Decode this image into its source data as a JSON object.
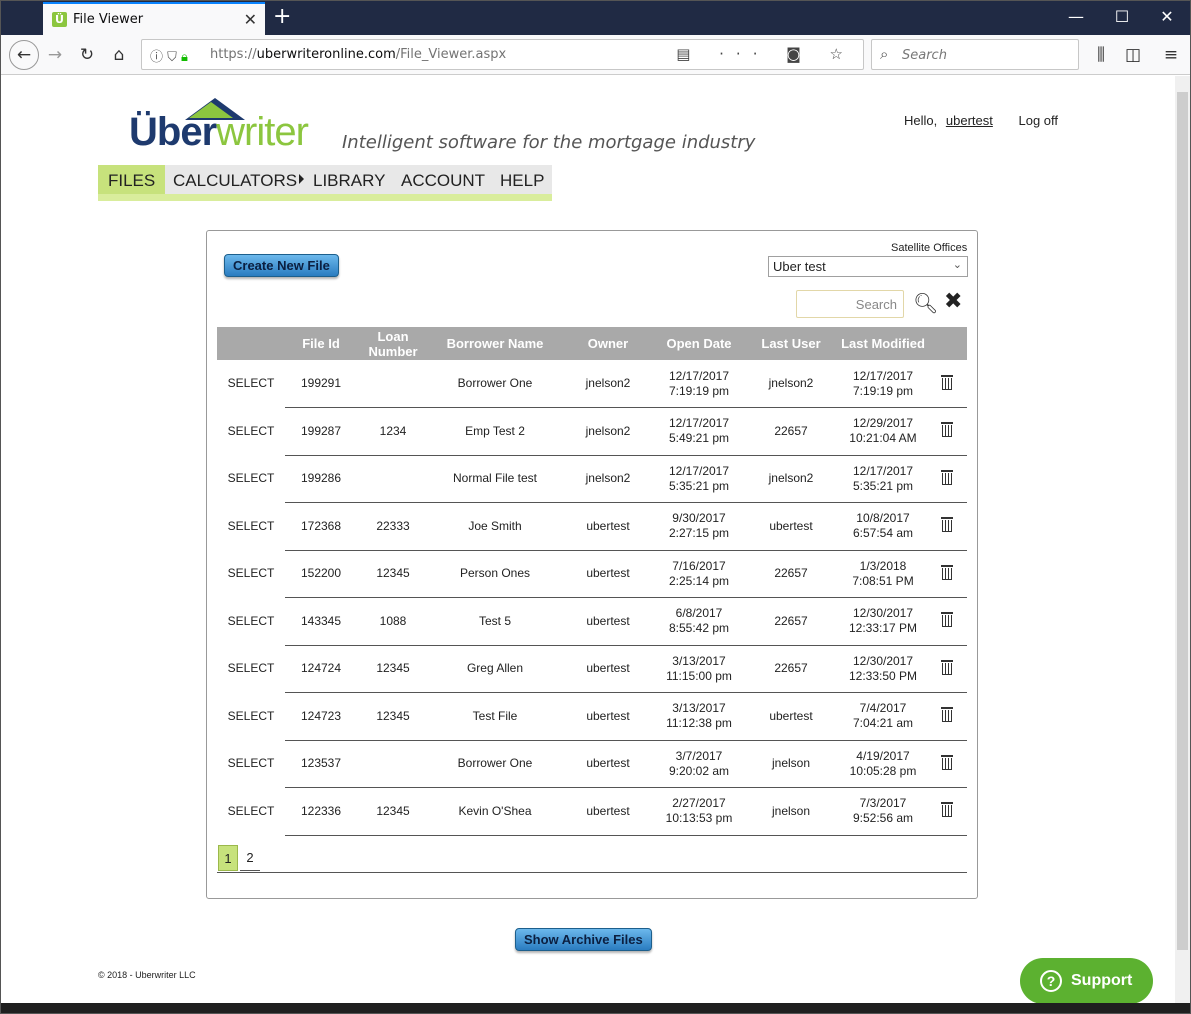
{
  "browser": {
    "tab_title": "File Viewer",
    "tab_close": "✕",
    "new_tab": "+",
    "win_min": "—",
    "win_max": "☐",
    "win_close": "✕",
    "url_prefix": "https://",
    "url_host": "uberwriteronline.com",
    "url_path": "/File_Viewer.aspx",
    "search_placeholder": "Search"
  },
  "brand": {
    "logo_main": "Über",
    "logo_accent": "writer",
    "tagline": "Intelligent software for the mortgage industry"
  },
  "user": {
    "greeting": "Hello,",
    "username": "ubertest",
    "logoff": "Log off"
  },
  "menu": {
    "files": "FILES",
    "calculators": "CALCULATORS",
    "library": "LIBRARY",
    "account": "ACCOUNT",
    "help": "HELP"
  },
  "panel": {
    "create_button": "Create New File",
    "satellite_label": "Satellite Offices",
    "satellite_value": "Uber test",
    "search_placeholder": "Search"
  },
  "table": {
    "headers": [
      "",
      "File Id",
      "Loan Number",
      "Borrower Name",
      "Owner",
      "Open Date",
      "Last User",
      "Last Modified",
      ""
    ],
    "rows": [
      {
        "select": "SELECT",
        "file_id": "199291",
        "loan": "",
        "borrower": "Borrower One",
        "owner": "jnelson2",
        "open_date": "12/17/2017",
        "open_time": "7:19:19 pm",
        "last_user": "jnelson2",
        "mod_date": "12/17/2017",
        "mod_time": "7:19:19 pm"
      },
      {
        "select": "SELECT",
        "file_id": "199287",
        "loan": "1234",
        "borrower": "Emp Test 2",
        "owner": "jnelson2",
        "open_date": "12/17/2017",
        "open_time": "5:49:21 pm",
        "last_user": "22657",
        "mod_date": "12/29/2017",
        "mod_time": "10:21:04 AM"
      },
      {
        "select": "SELECT",
        "file_id": "199286",
        "loan": "",
        "borrower": "Normal File test",
        "owner": "jnelson2",
        "open_date": "12/17/2017",
        "open_time": "5:35:21 pm",
        "last_user": "jnelson2",
        "mod_date": "12/17/2017",
        "mod_time": "5:35:21 pm"
      },
      {
        "select": "SELECT",
        "file_id": "172368",
        "loan": "22333",
        "borrower": "Joe Smith",
        "owner": "ubertest",
        "open_date": "9/30/2017",
        "open_time": "2:27:15 pm",
        "last_user": "ubertest",
        "mod_date": "10/8/2017",
        "mod_time": "6:57:54 am"
      },
      {
        "select": "SELECT",
        "file_id": "152200",
        "loan": "12345",
        "borrower": "Person Ones",
        "owner": "ubertest",
        "open_date": "7/16/2017",
        "open_time": "2:25:14 pm",
        "last_user": "22657",
        "mod_date": "1/3/2018",
        "mod_time": "7:08:51 PM"
      },
      {
        "select": "SELECT",
        "file_id": "143345",
        "loan": "1088",
        "borrower": "Test 5",
        "owner": "ubertest",
        "open_date": "6/8/2017",
        "open_time": "8:55:42 pm",
        "last_user": "22657",
        "mod_date": "12/30/2017",
        "mod_time": "12:33:17 PM"
      },
      {
        "select": "SELECT",
        "file_id": "124724",
        "loan": "12345",
        "borrower": "Greg Allen",
        "owner": "ubertest",
        "open_date": "3/13/2017",
        "open_time": "11:15:00 pm",
        "last_user": "22657",
        "mod_date": "12/30/2017",
        "mod_time": "12:33:50 PM"
      },
      {
        "select": "SELECT",
        "file_id": "124723",
        "loan": "12345",
        "borrower": "Test File",
        "owner": "ubertest",
        "open_date": "3/13/2017",
        "open_time": "11:12:38 pm",
        "last_user": "ubertest",
        "mod_date": "7/4/2017",
        "mod_time": "7:04:21 am"
      },
      {
        "select": "SELECT",
        "file_id": "123537",
        "loan": "",
        "borrower": "Borrower One",
        "owner": "ubertest",
        "open_date": "3/7/2017",
        "open_time": "9:20:02 am",
        "last_user": "jnelson",
        "mod_date": "4/19/2017",
        "mod_time": "10:05:28 pm"
      },
      {
        "select": "SELECT",
        "file_id": "122336",
        "loan": "12345",
        "borrower": "Kevin O'Shea",
        "owner": "ubertest",
        "open_date": "2/27/2017",
        "open_time": "10:13:53 pm",
        "last_user": "jnelson",
        "mod_date": "7/3/2017",
        "mod_time": "9:52:56 am"
      }
    ]
  },
  "pager": {
    "pages": [
      "1",
      "2"
    ],
    "current": "1"
  },
  "archive_button": "Show Archive Files",
  "footer": "© 2018 - Uberwriter LLC",
  "support": {
    "icon": "?",
    "label": "Support"
  },
  "colors": {
    "accent_green": "#8cc63f",
    "menu_active": "#c7e27c",
    "brand_navy": "#1e3a6e",
    "button_blue": "#2a7cc0",
    "header_gray": "#a9a9a9",
    "support_green": "#5cb130"
  }
}
